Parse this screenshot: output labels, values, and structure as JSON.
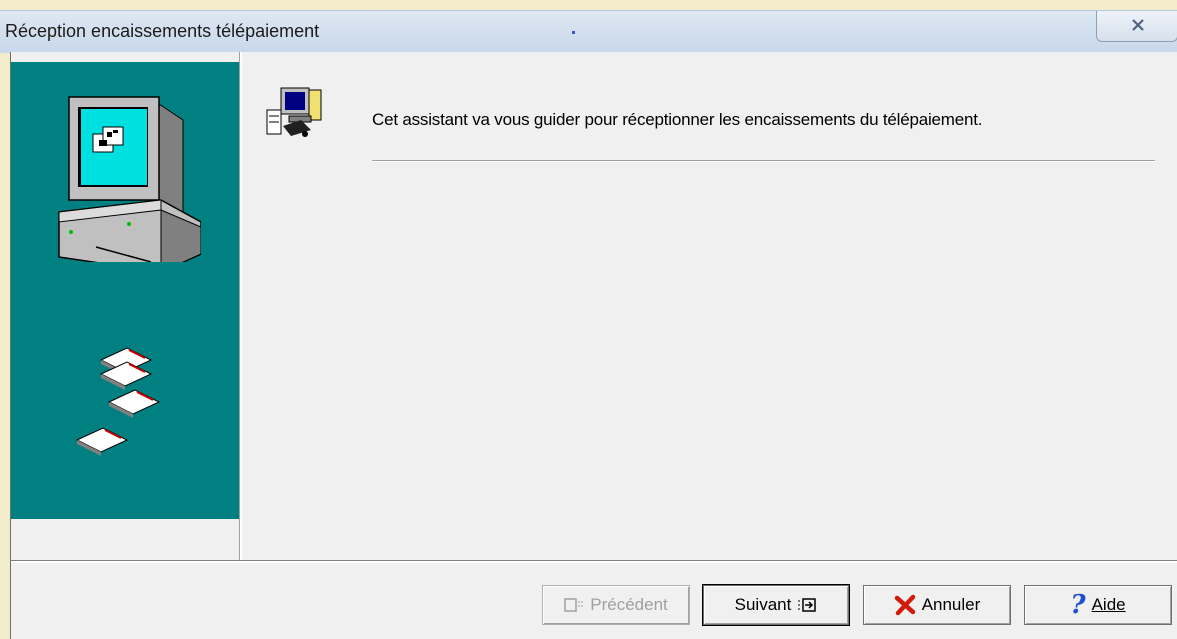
{
  "window": {
    "title": "Réception encaissements télépaiement"
  },
  "wizard": {
    "intro": "Cet assistant va vous guider pour réceptionner les encaissements du télépaiement."
  },
  "buttons": {
    "previous": "Précédent",
    "next": "Suivant",
    "cancel": "Annuler",
    "help": "Aide"
  },
  "icons": {
    "close": "close-icon",
    "computer": "computer-icon",
    "disks": "floppy-disk-icon",
    "wizard": "wizard-computer-icon",
    "previous": "previous-arrow-icon",
    "next": "next-arrow-icon",
    "cancel": "red-x-icon",
    "help": "question-mark-icon"
  },
  "colors": {
    "side_panel": "#008080",
    "title_bar": "#dfe8f3",
    "cancel_icon": "#d01a0a",
    "help_icon": "#1f4fd0"
  }
}
